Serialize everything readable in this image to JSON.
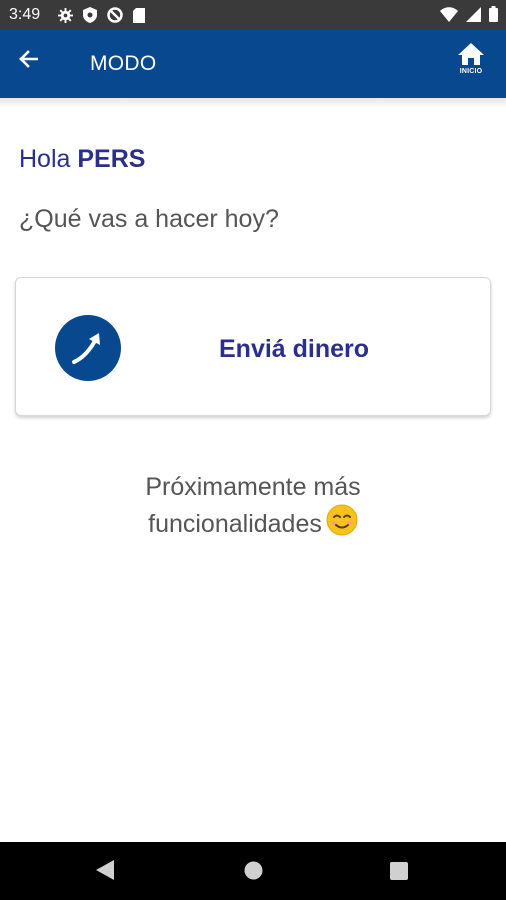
{
  "status_bar": {
    "time": "3:49",
    "icons_left": [
      "settings-icon",
      "shield-icon",
      "no-disturb-icon",
      "sim-card-icon"
    ],
    "icons_right": [
      "wifi-icon",
      "signal-icon",
      "battery-icon"
    ]
  },
  "app_bar": {
    "title": "MODO",
    "home_label": "INICIO",
    "background": "#07488f"
  },
  "greeting": {
    "prefix": "Hola",
    "name": "PERS"
  },
  "question": "¿Qué vas a hacer hoy?",
  "action_card": {
    "label": "Enviá dinero",
    "icon": "send-arrow-icon"
  },
  "coming_soon": {
    "line1": "Próximamente más",
    "line2": "funcionalidades",
    "emoji": "smiling-face-icon"
  },
  "nav_bar": {
    "buttons": [
      "back-triangle-icon",
      "home-circle-icon",
      "recents-square-icon"
    ]
  },
  "colors": {
    "brand_blue": "#07488f",
    "text_blue": "#2b2f8c",
    "text_gray": "#555555"
  }
}
